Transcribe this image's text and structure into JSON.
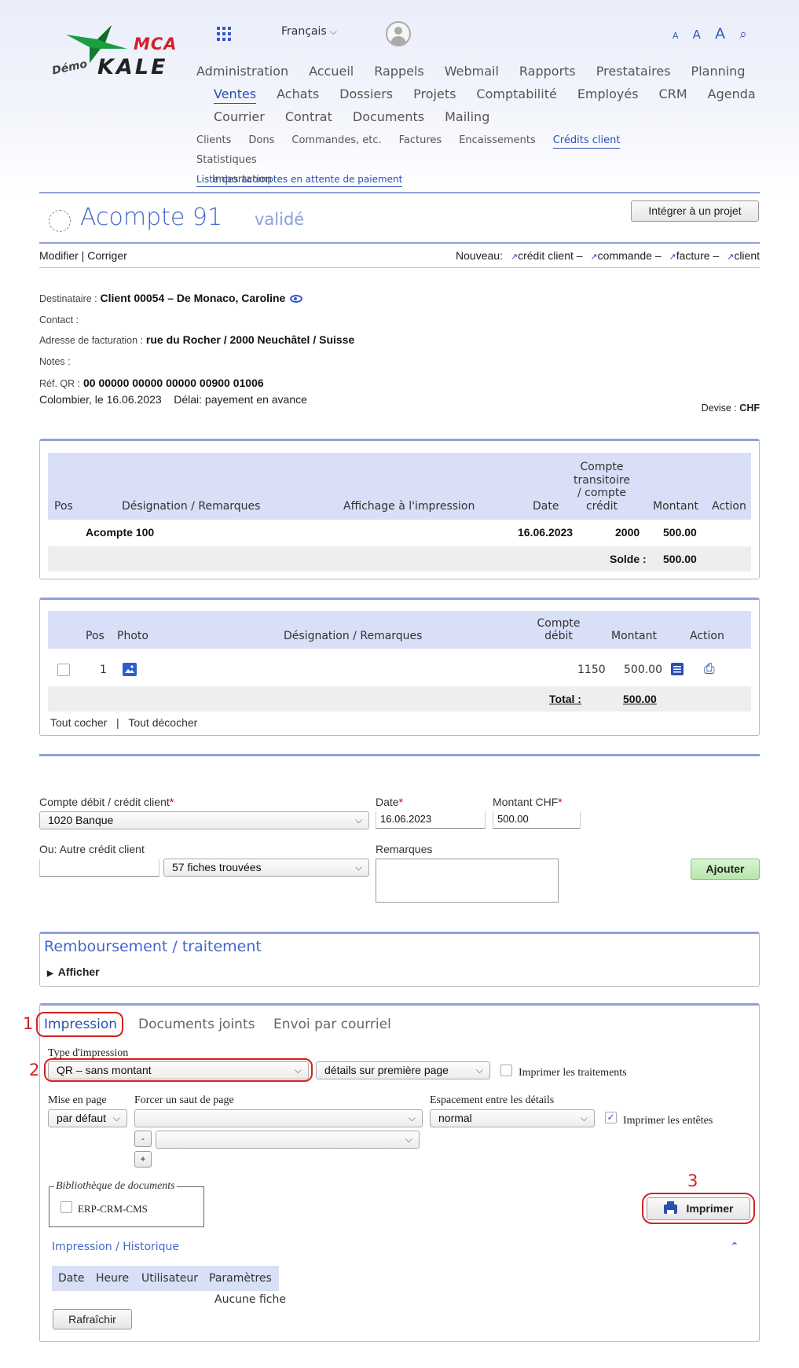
{
  "logo": {
    "brand_top": "MCA",
    "brand_bottom": "KALE",
    "demo": "Démo"
  },
  "header": {
    "language": "Français",
    "font_sizes": [
      "A",
      "A",
      "A"
    ]
  },
  "nav": {
    "main": [
      "Administration",
      "Accueil",
      "Rappels",
      "Webmail",
      "Rapports",
      "Prestataires",
      "Planning",
      "Ventes",
      "Achats",
      "Dossiers",
      "Projets",
      "Comptabilité",
      "Employés",
      "CRM",
      "Agenda",
      "Courrier",
      "Contrat",
      "Documents",
      "Mailing"
    ],
    "main_active": "Ventes",
    "sub": [
      "Clients",
      "Dons",
      "Commandes, etc.",
      "Factures",
      "Encaissements",
      "Crédits client",
      "Statistiques",
      "Importation"
    ],
    "sub_active": "Crédits client",
    "third": "Liste des acomptes en attente de paiement"
  },
  "page": {
    "title": "Acompte 91",
    "status": "validé",
    "integrate_button": "Intégrer à un projet",
    "actions": "Modifier | Corriger",
    "nouveau_label": "Nouveau:",
    "nouveau_items": [
      "crédit client –",
      "commande –",
      "facture –",
      "client"
    ]
  },
  "info": {
    "destinataire_label": "Destinataire :",
    "destinataire_value": "Client 00054 – De Monaco, Caroline",
    "contact_label": "Contact :",
    "adresse_label": "Adresse de facturation :",
    "adresse_value": "rue du Rocher / 2000 Neuchâtel / Suisse",
    "notes_label": "Notes :",
    "refqr_label": "Réf. QR :",
    "refqr_value": "00 00000 00000 00000 00900 01006",
    "date_line": "Colombier, le 16.06.2023",
    "delai": "Délai: payement en avance",
    "devise_label": "Devise :",
    "devise_value": "CHF"
  },
  "table1": {
    "headers": {
      "pos": "Pos",
      "designation": "Désignation / Remarques",
      "affichage": "Affichage à l'impression",
      "date": "Date",
      "compte1": "Compte",
      "compte2": "transitoire",
      "compte3": "/ compte",
      "compte4": "crédit",
      "montant": "Montant",
      "action": "Action"
    },
    "row": {
      "designation": "Acompte 100",
      "date": "16.06.2023",
      "compte": "2000",
      "montant": "500.00"
    },
    "solde_label": "Solde :",
    "solde_value": "500.00"
  },
  "table2": {
    "headers": {
      "pos": "Pos",
      "photo": "Photo",
      "designation": "Désignation / Remarques",
      "compte1": "Compte",
      "compte2": "débit",
      "montant": "Montant",
      "action": "Action"
    },
    "row": {
      "pos": "1",
      "compte": "1150",
      "montant": "500.00"
    },
    "total_label": "Total :",
    "total_value": "500.00",
    "check_all": "Tout cocher",
    "uncheck_all": "Tout décocher"
  },
  "form": {
    "compte_label": "Compte débit / crédit client",
    "compte_value": "1020   Banque",
    "date_label": "Date",
    "date_value": "16.06.2023",
    "montant_label": "Montant CHF",
    "montant_value": "500.00",
    "autre_label": "Ou: Autre crédit client",
    "fiches_value": "57 fiches trouvées",
    "remarques_label": "Remarques",
    "ajouter": "Ajouter"
  },
  "remboursement": {
    "title": "Remboursement / traitement",
    "afficher": "Afficher"
  },
  "impression": {
    "tabs": [
      "Impression",
      "Documents joints",
      "Envoi par courriel"
    ],
    "type_label": "Type d'impression",
    "type_value": "QR – sans montant",
    "details_value": "détails sur première page",
    "imprimer_traitements": "Imprimer les traitements",
    "mise_label": "Mise en page",
    "mise_value": "par défaut",
    "saut_label": "Forcer un saut de page",
    "espacement_label": "Espacement entre les détails",
    "espacement_value": "normal",
    "imprimer_entetes": "Imprimer les entêtes",
    "minus": "-",
    "plus": "+",
    "biblio_label": "Bibliothèque de documents",
    "biblio_item": "ERP-CRM-CMS",
    "imprimer_button": "Imprimer",
    "historique_title": "Impression / Historique",
    "hist_headers": [
      "Date",
      "Heure",
      "Utilisateur",
      "Paramètres"
    ],
    "hist_empty": "Aucune fiche",
    "rafraichir": "Rafraîchir",
    "annotations": [
      "1",
      "2",
      "3"
    ]
  },
  "colors": {
    "accent": "#2b4fb0",
    "header_bg": "#d8dff6",
    "annotation": "#d42020",
    "add_button": "#c6eebb"
  }
}
